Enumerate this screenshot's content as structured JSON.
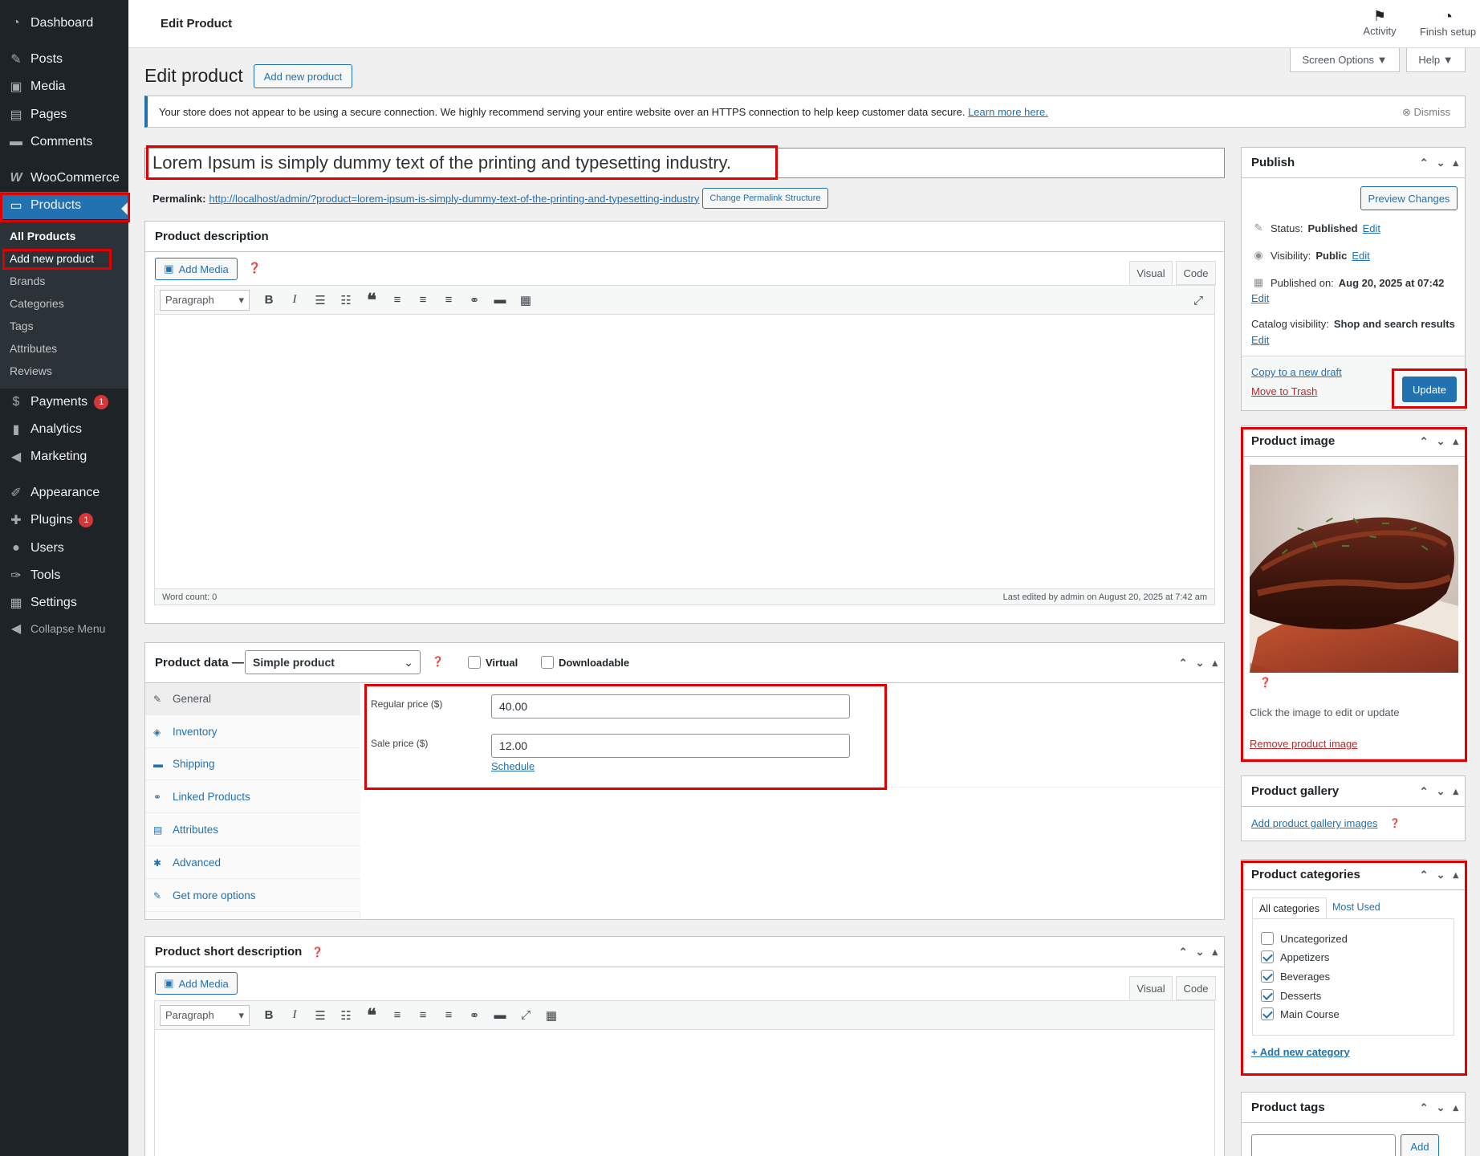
{
  "sidebar": {
    "items": [
      {
        "label": "Dashboard",
        "icon": "dashboard-icon",
        "glyph": "◔"
      },
      {
        "label": "Posts",
        "icon": "pin-icon",
        "glyph": "✎"
      },
      {
        "label": "Media",
        "icon": "media-icon",
        "glyph": "▣"
      },
      {
        "label": "Pages",
        "icon": "pages-icon",
        "glyph": "▤"
      },
      {
        "label": "Comments",
        "icon": "comment-icon",
        "glyph": "▬"
      },
      {
        "label": "WooCommerce",
        "icon": "woo-icon",
        "glyph": "W"
      },
      {
        "label": "Products",
        "icon": "products-icon",
        "glyph": "▭"
      },
      {
        "label": "Payments",
        "icon": "payments-icon",
        "glyph": "$",
        "badge": "1"
      },
      {
        "label": "Analytics",
        "icon": "analytics-icon",
        "glyph": "▮"
      },
      {
        "label": "Marketing",
        "icon": "megaphone-icon",
        "glyph": "◀"
      },
      {
        "label": "Appearance",
        "icon": "brush-icon",
        "glyph": "✐"
      },
      {
        "label": "Plugins",
        "icon": "plugin-icon",
        "glyph": "✚",
        "badge": "1"
      },
      {
        "label": "Users",
        "icon": "user-icon",
        "glyph": "●"
      },
      {
        "label": "Tools",
        "icon": "wrench-icon",
        "glyph": "✑"
      },
      {
        "label": "Settings",
        "icon": "settings-icon",
        "glyph": "▦"
      },
      {
        "label": "Collapse Menu",
        "icon": "collapse-icon",
        "glyph": "◀"
      }
    ],
    "submenu": [
      "All Products",
      "Add new product",
      "Brands",
      "Categories",
      "Tags",
      "Attributes",
      "Reviews"
    ]
  },
  "topbar": {
    "title": "Edit Product",
    "activity": "Activity",
    "finish_setup": "Finish setup"
  },
  "header": {
    "title": "Edit product",
    "add_new": "Add new product",
    "screen_options": "Screen Options ▼",
    "help": "Help ▼"
  },
  "notice": {
    "text": "Your store does not appear to be using a secure connection. We highly recommend serving your entire website over an HTTPS connection to help keep customer data secure.",
    "link": "Learn more here.",
    "dismiss": "Dismiss"
  },
  "post": {
    "title": "Lorem Ipsum is simply dummy text of the printing and typesetting industry.",
    "permalink_label": "Permalink:",
    "permalink_url": "http://localhost/admin/?product=lorem-ipsum-is-simply-dummy-text-of-the-printing-and-typesetting-industry",
    "change_permalink": "Change Permalink Structure"
  },
  "description": {
    "heading": "Product description",
    "add_media": "Add Media",
    "visual": "Visual",
    "code": "Code",
    "paragraph": "Paragraph",
    "word_count": "Word count: 0",
    "last_edited": "Last edited by admin on August 20, 2025 at 7:42 am"
  },
  "product_data": {
    "heading": "Product data —",
    "type": "Simple product",
    "virtual": "Virtual",
    "downloadable": "Downloadable",
    "tabs": [
      {
        "label": "General",
        "glyph": "✎"
      },
      {
        "label": "Inventory",
        "glyph": "◈"
      },
      {
        "label": "Shipping",
        "glyph": "▬"
      },
      {
        "label": "Linked Products",
        "glyph": "⚭"
      },
      {
        "label": "Attributes",
        "glyph": "▤"
      },
      {
        "label": "Advanced",
        "glyph": "✱"
      },
      {
        "label": "Get more options",
        "glyph": "✎"
      }
    ],
    "regular_price_label": "Regular price ($)",
    "regular_price": "40.00",
    "sale_price_label": "Sale price ($)",
    "sale_price": "12.00",
    "schedule": "Schedule"
  },
  "short_description": {
    "heading": "Product short description",
    "add_media": "Add Media",
    "visual": "Visual",
    "code": "Code",
    "paragraph": "Paragraph"
  },
  "publish": {
    "heading": "Publish",
    "preview": "Preview Changes",
    "status_label": "Status:",
    "status": "Published",
    "edit": "Edit",
    "visibility_label": "Visibility:",
    "visibility": "Public",
    "published_on_label": "Published on:",
    "published_on": "Aug 20, 2025 at 07:42",
    "catalog_label": "Catalog visibility:",
    "catalog": "Shop and search results",
    "copy_draft": "Copy to a new draft",
    "trash": "Move to Trash",
    "update": "Update"
  },
  "product_image": {
    "heading": "Product image",
    "hint": "Click the image to edit or update",
    "remove": "Remove product image"
  },
  "gallery": {
    "heading": "Product gallery",
    "add": "Add product gallery images"
  },
  "categories": {
    "heading": "Product categories",
    "tab_all": "All categories",
    "tab_used": "Most Used",
    "items": [
      {
        "label": "Uncategorized",
        "checked": false
      },
      {
        "label": "Appetizers",
        "checked": true
      },
      {
        "label": "Beverages",
        "checked": true
      },
      {
        "label": "Desserts",
        "checked": true
      },
      {
        "label": "Main Course",
        "checked": true
      }
    ],
    "add_new": "+ Add new category"
  },
  "tags": {
    "heading": "Product tags",
    "add": "Add"
  },
  "colors": {
    "accent": "#2271b1",
    "sidebar": "#1d2327",
    "highlight": "#e00000",
    "badge": "#d63638"
  }
}
